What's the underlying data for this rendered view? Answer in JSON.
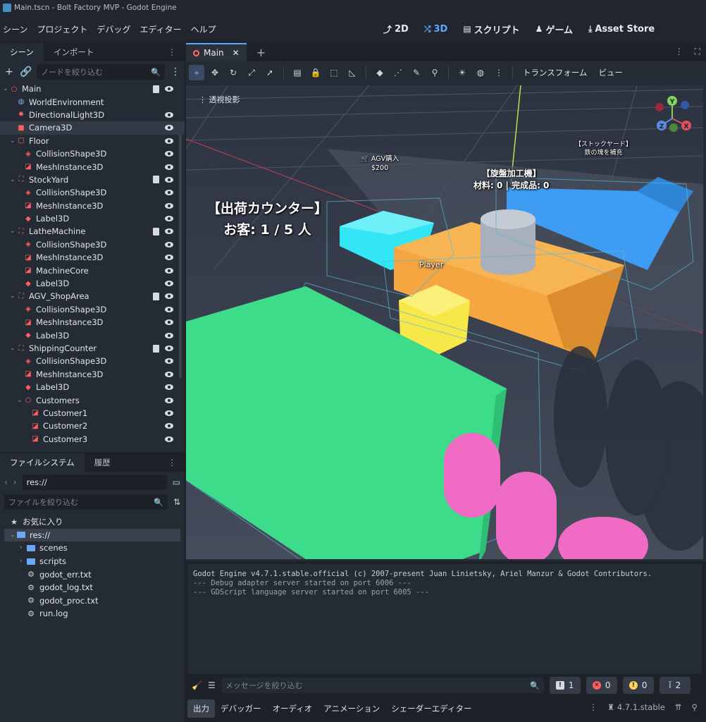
{
  "window": {
    "title": "Main.tscn - Bolt Factory MVP - Godot Engine"
  },
  "menu": [
    "シーン",
    "プロジェクト",
    "デバッグ",
    "エディター",
    "ヘルプ"
  ],
  "modes": [
    {
      "label": "2D",
      "icon": "2d-icon",
      "active": false
    },
    {
      "label": "3D",
      "icon": "3d-icon",
      "active": true
    },
    {
      "label": "スクリプト",
      "icon": "script-icon",
      "active": false
    },
    {
      "label": "ゲーム",
      "icon": "game-icon",
      "active": false
    },
    {
      "label": "Asset Store",
      "icon": "asset-store-icon",
      "active": false
    }
  ],
  "scene_dock": {
    "tabs": [
      "シーン",
      "インポート"
    ],
    "filter_placeholder": "ノードを絞り込む",
    "nodes": [
      {
        "label": "Main",
        "depth": 0,
        "arrow": "v",
        "icon": "node3d-icon",
        "script": true,
        "eye": true
      },
      {
        "label": "WorldEnvironment",
        "depth": 1,
        "arrow": "",
        "icon": "world-environment-icon",
        "script": false,
        "eye": false
      },
      {
        "label": "DirectionalLight3D",
        "depth": 1,
        "arrow": "",
        "icon": "light-icon",
        "script": false,
        "eye": true
      },
      {
        "label": "Camera3D",
        "depth": 1,
        "arrow": "",
        "icon": "camera-icon",
        "script": false,
        "eye": true,
        "selected": true
      },
      {
        "label": "Floor",
        "depth": 1,
        "arrow": "v",
        "icon": "static-body-icon",
        "script": false,
        "eye": true
      },
      {
        "label": "CollisionShape3D",
        "depth": 2,
        "arrow": "",
        "icon": "collision-shape-icon",
        "script": false,
        "eye": true
      },
      {
        "label": "MeshInstance3D",
        "depth": 2,
        "arrow": "",
        "icon": "mesh-instance-icon",
        "script": false,
        "eye": true
      },
      {
        "label": "StockYard",
        "depth": 1,
        "arrow": "v",
        "icon": "area-icon",
        "script": true,
        "eye": true
      },
      {
        "label": "CollisionShape3D",
        "depth": 2,
        "arrow": "",
        "icon": "collision-shape-icon",
        "script": false,
        "eye": true
      },
      {
        "label": "MeshInstance3D",
        "depth": 2,
        "arrow": "",
        "icon": "mesh-instance-icon",
        "script": false,
        "eye": true
      },
      {
        "label": "Label3D",
        "depth": 2,
        "arrow": "",
        "icon": "label3d-icon",
        "script": false,
        "eye": true
      },
      {
        "label": "LatheMachine",
        "depth": 1,
        "arrow": "v",
        "icon": "area-icon",
        "script": true,
        "eye": true
      },
      {
        "label": "CollisionShape3D",
        "depth": 2,
        "arrow": "",
        "icon": "collision-shape-icon",
        "script": false,
        "eye": true
      },
      {
        "label": "MeshInstance3D",
        "depth": 2,
        "arrow": "",
        "icon": "mesh-instance-icon",
        "script": false,
        "eye": true
      },
      {
        "label": "MachineCore",
        "depth": 2,
        "arrow": "",
        "icon": "mesh-instance-icon",
        "script": false,
        "eye": true
      },
      {
        "label": "Label3D",
        "depth": 2,
        "arrow": "",
        "icon": "label3d-icon",
        "script": false,
        "eye": true
      },
      {
        "label": "AGV_ShopArea",
        "depth": 1,
        "arrow": "v",
        "icon": "area-icon",
        "script": true,
        "eye": true
      },
      {
        "label": "CollisionShape3D",
        "depth": 2,
        "arrow": "",
        "icon": "collision-shape-icon",
        "script": false,
        "eye": true
      },
      {
        "label": "MeshInstance3D",
        "depth": 2,
        "arrow": "",
        "icon": "mesh-instance-icon",
        "script": false,
        "eye": true
      },
      {
        "label": "Label3D",
        "depth": 2,
        "arrow": "",
        "icon": "label3d-icon",
        "script": false,
        "eye": true
      },
      {
        "label": "ShippingCounter",
        "depth": 1,
        "arrow": "v",
        "icon": "area-icon",
        "script": true,
        "eye": true
      },
      {
        "label": "CollisionShape3D",
        "depth": 2,
        "arrow": "",
        "icon": "collision-shape-icon",
        "script": false,
        "eye": true
      },
      {
        "label": "MeshInstance3D",
        "depth": 2,
        "arrow": "",
        "icon": "mesh-instance-icon",
        "script": false,
        "eye": true
      },
      {
        "label": "Label3D",
        "depth": 2,
        "arrow": "",
        "icon": "label3d-icon",
        "script": false,
        "eye": true
      },
      {
        "label": "Customers",
        "depth": 2,
        "arrow": "v",
        "icon": "node3d-icon",
        "script": false,
        "eye": true
      },
      {
        "label": "Customer1",
        "depth": 3,
        "arrow": "",
        "icon": "mesh-instance-icon",
        "script": false,
        "eye": true
      },
      {
        "label": "Customer2",
        "depth": 3,
        "arrow": "",
        "icon": "mesh-instance-icon",
        "script": false,
        "eye": true
      },
      {
        "label": "Customer3",
        "depth": 3,
        "arrow": "",
        "icon": "mesh-instance-icon",
        "script": false,
        "eye": true
      }
    ]
  },
  "filesystem": {
    "tabs": [
      "ファイルシステム",
      "履歴"
    ],
    "path": "res://",
    "filter_placeholder": "ファイルを絞り込む",
    "items": [
      {
        "label": "お気に入り",
        "type": "favorites",
        "depth": 0
      },
      {
        "label": "res://",
        "type": "folder-open",
        "depth": 0,
        "selected": true
      },
      {
        "label": "scenes",
        "type": "folder",
        "depth": 1
      },
      {
        "label": "scripts",
        "type": "folder",
        "depth": 1
      },
      {
        "label": "godot_err.txt",
        "type": "file",
        "depth": 1
      },
      {
        "label": "godot_log.txt",
        "type": "file",
        "depth": 1
      },
      {
        "label": "godot_proc.txt",
        "type": "file",
        "depth": 1
      },
      {
        "label": "run.log",
        "type": "file",
        "depth": 1
      }
    ]
  },
  "editor": {
    "tab": "Main",
    "toolbar_text": [
      "トランスフォーム",
      "ビュー"
    ],
    "viewport": {
      "perspective_label": "透視投影",
      "labels": {
        "shipping": "【出荷カウンター】\nお客: 1 / 5 人",
        "lathe": "【旋盤加工機】\n材料: 0 | 完成品: 0",
        "agv_title": "AGV購入",
        "agv_price": "$200",
        "stockyard": "【ストックヤード】\n鉄の塊を補充",
        "player": "Player"
      },
      "gizmo_axes": [
        "Y",
        "X",
        "Z"
      ]
    }
  },
  "output": {
    "lines": [
      "Godot Engine v4.7.1.stable.official (c) 2007-present Juan Linietsky, Ariel Manzur & Godot Contributors.",
      "--- Debug adapter server started on port 6006 ---",
      "--- GDScript language server started on port 6005 ---"
    ],
    "filter_placeholder": "メッセージを絞り込む",
    "counts": {
      "messages": "1",
      "errors": "0",
      "warnings": "0",
      "other": "2"
    },
    "tabs": [
      "出力",
      "デバッガー",
      "オーディオ",
      "アニメーション",
      "シェーダーエディター"
    ],
    "version": "4.7.1.stable"
  },
  "colors": {
    "accent": "#5aa8ff",
    "node_red": "#ff5f5f",
    "floor_green": "#3ddc8a",
    "machine_orange": "#f5a640",
    "stock_blue": "#3e9df2",
    "agv_cyan": "#33e6f5",
    "player_yellow": "#f7e84a",
    "customer_pink": "#f06bc4"
  }
}
